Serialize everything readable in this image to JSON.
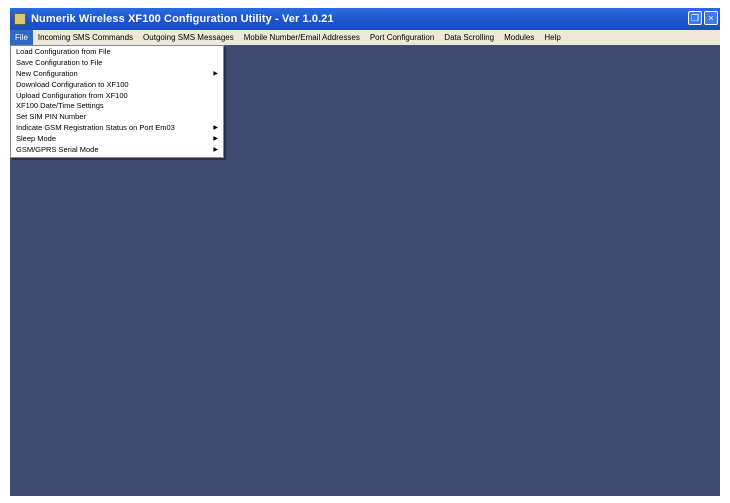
{
  "window": {
    "title": "Numerik Wireless XF100 Configuration Utility - Ver 1.0.21"
  },
  "menubar": {
    "items": [
      {
        "label": "File",
        "active": true
      },
      {
        "label": "Incoming SMS Commands",
        "active": false
      },
      {
        "label": "Outgoing SMS Messages",
        "active": false
      },
      {
        "label": "Mobile Number/Email Addresses",
        "active": false
      },
      {
        "label": "Port Configuration",
        "active": false
      },
      {
        "label": "Data Scrolling",
        "active": false
      },
      {
        "label": "Modules",
        "active": false
      },
      {
        "label": "Help",
        "active": false
      }
    ]
  },
  "file_menu": {
    "items": [
      {
        "label": "Load Configuration from File",
        "submenu": false
      },
      {
        "label": "Save Configuration to File",
        "submenu": false
      },
      {
        "label": "New Configuration",
        "submenu": true
      },
      {
        "label": "Download Configuration to XF100",
        "submenu": false
      },
      {
        "label": "Upload Configuration from XF100",
        "submenu": false
      },
      {
        "label": "XF100 Date/Time Settings",
        "submenu": false
      },
      {
        "label": "Set SIM PIN Number",
        "submenu": false
      },
      {
        "label": "Indicate GSM Registration Status on Port Em03",
        "submenu": true
      },
      {
        "label": "Sleep Mode",
        "submenu": true
      },
      {
        "label": "GSM/GPRS Serial Mode",
        "submenu": true
      }
    ]
  },
  "colors": {
    "desktop": "#3d4c70",
    "titlebar": "#1f58d0",
    "menubar": "#ece9d8",
    "menu_highlight": "#316ac5"
  }
}
